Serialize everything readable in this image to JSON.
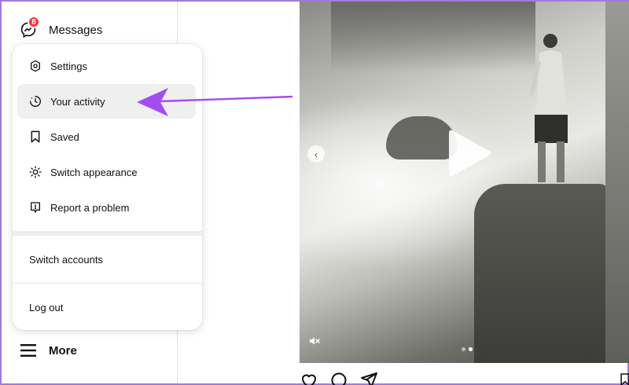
{
  "sidebar": {
    "messages_label": "Messages",
    "messages_badge": "8",
    "more_label": "More"
  },
  "menu": {
    "items": [
      {
        "label": "Settings",
        "icon": "settings-icon"
      },
      {
        "label": "Your activity",
        "icon": "activity-icon"
      },
      {
        "label": "Saved",
        "icon": "bookmark-icon"
      },
      {
        "label": "Switch appearance",
        "icon": "sun-icon"
      },
      {
        "label": "Report a problem",
        "icon": "report-icon"
      }
    ],
    "switch_accounts": "Switch accounts",
    "log_out": "Log out"
  },
  "annotation": {
    "color": "#a34df0"
  },
  "media": {
    "carousel_index": 2,
    "carousel_total": 2
  },
  "colors": {
    "badge": "#ff3040",
    "active_item": "#efefef"
  }
}
